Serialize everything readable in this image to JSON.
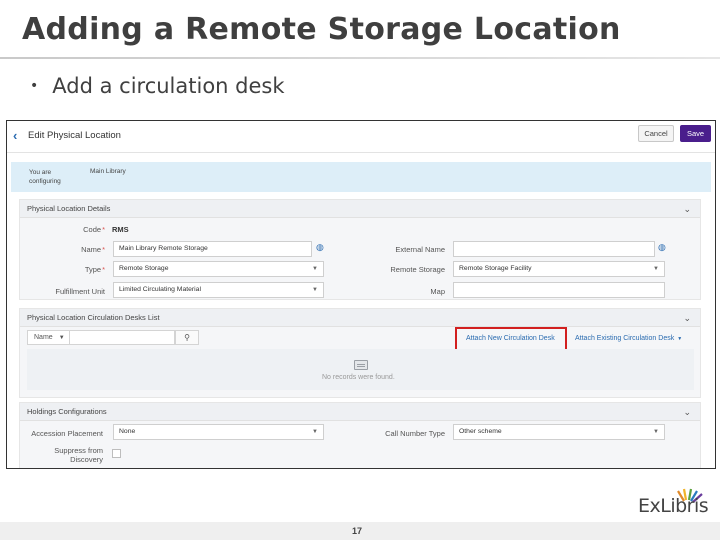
{
  "slide": {
    "title": "Adding a Remote Storage Location",
    "bullet": "Add a circulation desk",
    "page_number": "17",
    "logo": "ExLibris"
  },
  "screen": {
    "header": {
      "back_icon": "chevron-left-icon",
      "title": "Edit Physical Location",
      "cancel_label": "Cancel",
      "save_label": "Save"
    },
    "context": {
      "label": "You are configuring",
      "value": "Main Library"
    },
    "details": {
      "title": "Physical Location Details",
      "code_label": "Code",
      "code_value": "RMS",
      "name_label": "Name",
      "name_value": "Main Library Remote Storage",
      "type_label": "Type",
      "type_value": "Remote Storage",
      "fulfillment_label": "Fulfillment Unit",
      "fulfillment_value": "Limited Circulating Material",
      "external_name_label": "External Name",
      "external_name_value": "",
      "remote_storage_label": "Remote Storage",
      "remote_storage_value": "Remote Storage Facility",
      "map_label": "Map",
      "map_value": ""
    },
    "desks": {
      "title": "Physical Location Circulation Desks List",
      "filter_label": "Name",
      "attach_new": "Attach New Circulation Desk",
      "attach_existing": "Attach Existing Circulation Desk",
      "empty_text": "No records were found."
    },
    "holdings": {
      "title": "Holdings Configurations",
      "accession_label": "Accession Placement",
      "accession_value": "None",
      "call_number_label": "Call Number Type",
      "call_number_value": "Other scheme",
      "suppress_label_1": "Suppress from",
      "suppress_label_2": "Discovery",
      "suppress_checked": false
    },
    "colors": {
      "save_button": "#4a1e8c",
      "link": "#2a6bb0",
      "highlight": "#d21f1f",
      "context_bar": "#ddeef8"
    }
  }
}
